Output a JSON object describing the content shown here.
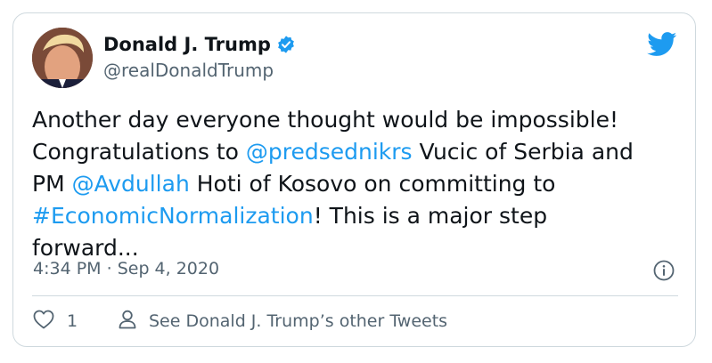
{
  "author": {
    "display_name": "Donald J. Trump",
    "handle": "@realDonaldTrump",
    "verified": true
  },
  "tweet": {
    "line1": "Another day everyone thought would be impossible!",
    "line2_pre": "Congratulations to ",
    "mention1": "@predsednikrs",
    "line2_post": " Vucic of Serbia and",
    "line3_pre": "PM ",
    "mention2": "@Avdullah",
    "line3_post": " Hoti of Kosovo on committing to",
    "hashtag": "#EconomicNormalization",
    "line4_post": "! This is a major step",
    "line5": "forward..."
  },
  "meta": {
    "time": "4:34 PM",
    "separator": "·",
    "date": "Sep 4, 2020"
  },
  "actions": {
    "like_count": "1",
    "other_tweets_label": "See Donald J. Trump’s other Tweets"
  },
  "colors": {
    "link": "#1d9bf0",
    "text": "#0f1419",
    "secondary": "#536471",
    "border": "#cfd9de"
  },
  "icons": [
    "twitter-bird-icon",
    "verified-badge-icon",
    "info-icon",
    "heart-icon",
    "person-icon"
  ]
}
